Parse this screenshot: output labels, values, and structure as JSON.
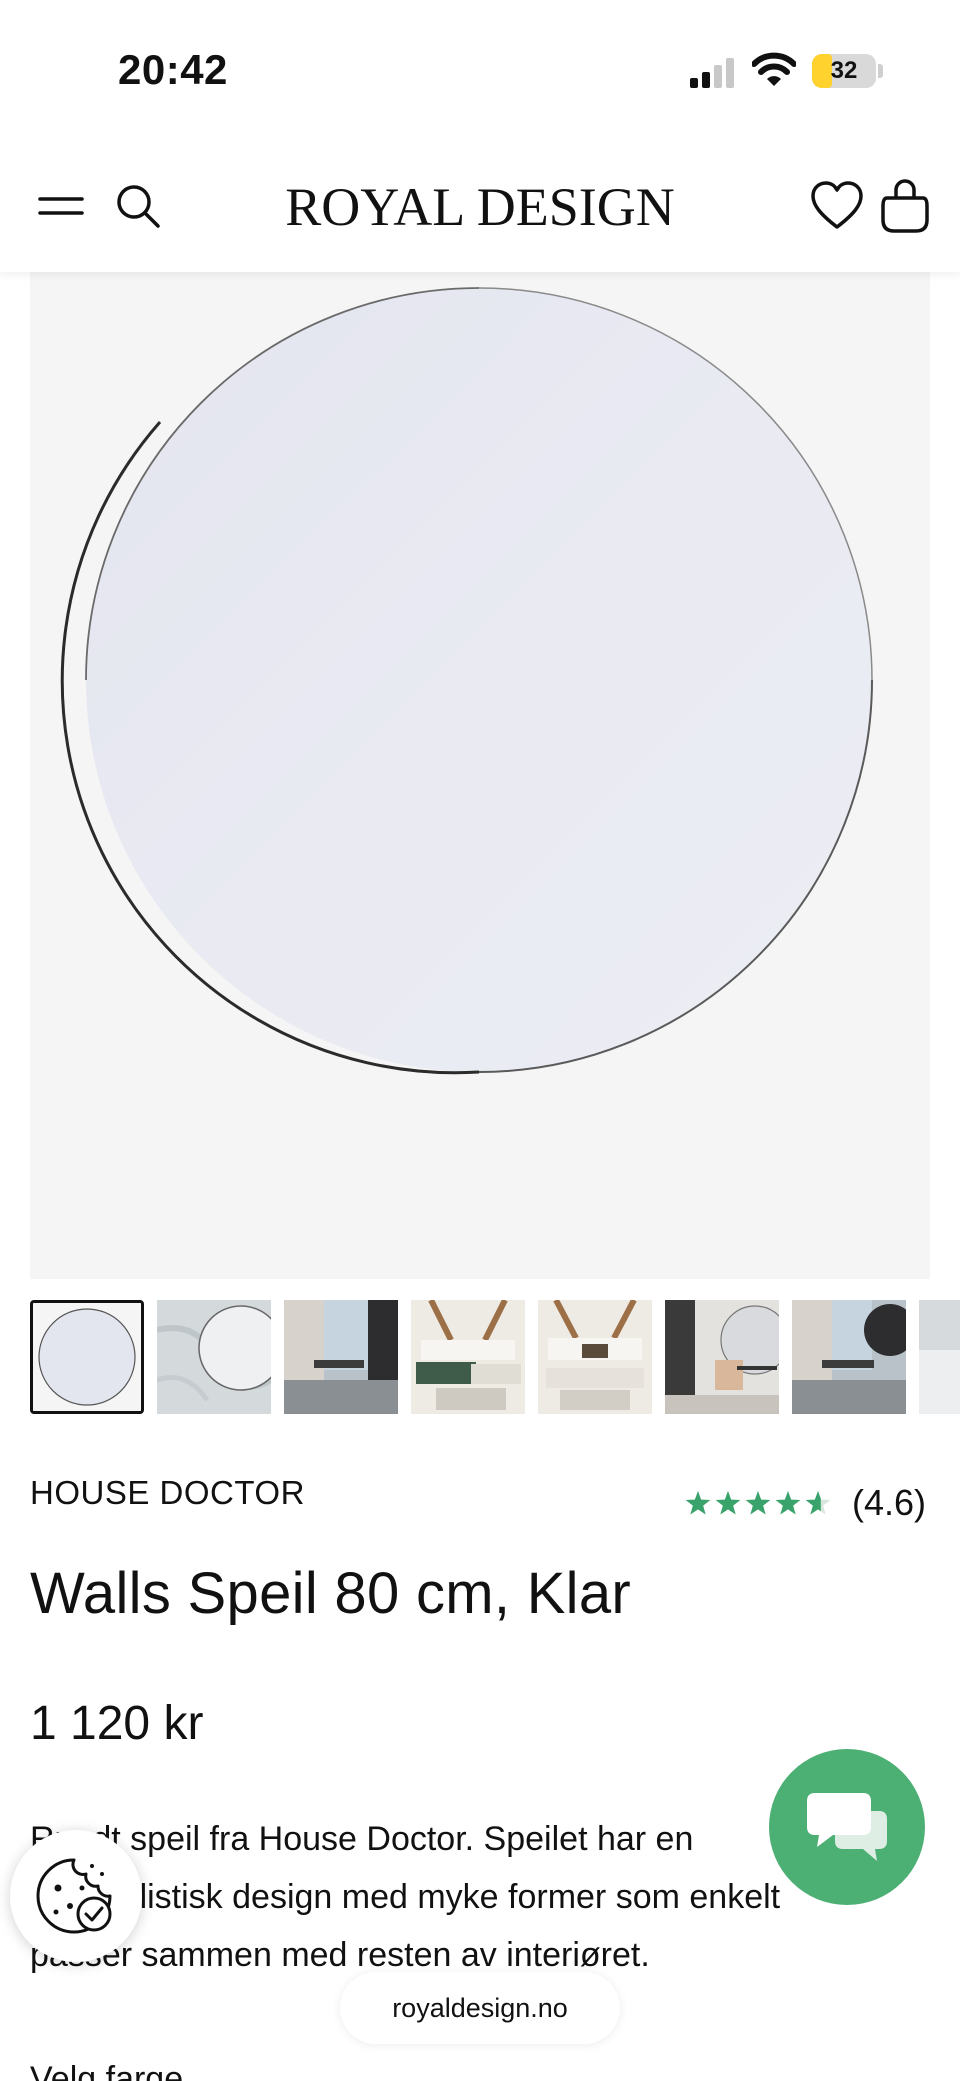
{
  "status_bar": {
    "time": "20:42",
    "battery": "32",
    "battery_level": 0.32
  },
  "header": {
    "logo": "ROYAL DESIGN"
  },
  "product": {
    "brand": "HOUSE DOCTOR",
    "rating": "(4.6)",
    "rating_value": 4.6,
    "title": "Walls Speil 80 cm, Klar",
    "price": "1 120 kr",
    "description": "Rundt speil fra House Doctor. Speilet har en minimalistisk design med myke former som enkelt passer sammen med resten av interiøret.",
    "choose_color_label": "Velg farge"
  },
  "thumbnails": [
    {
      "name": "mirror-front",
      "active": true
    },
    {
      "name": "mirror-wall-marble",
      "active": false
    },
    {
      "name": "interior-dining",
      "active": false
    },
    {
      "name": "interior-sofa-green",
      "active": false
    },
    {
      "name": "interior-living-room",
      "active": false
    },
    {
      "name": "interior-chair-corner",
      "active": false
    },
    {
      "name": "interior-dining-2",
      "active": false
    },
    {
      "name": "interior-partial",
      "active": false
    }
  ],
  "url": "royaldesign.no",
  "colors": {
    "accent_green": "#4caf73",
    "star_green": "#3aa36b",
    "battery_yellow": "#ffd22e"
  },
  "icons": [
    "menu-icon",
    "search-icon",
    "heart-icon",
    "bag-icon",
    "star-icon",
    "cookie-icon",
    "chat-icon",
    "signal-icon",
    "wifi-icon"
  ]
}
